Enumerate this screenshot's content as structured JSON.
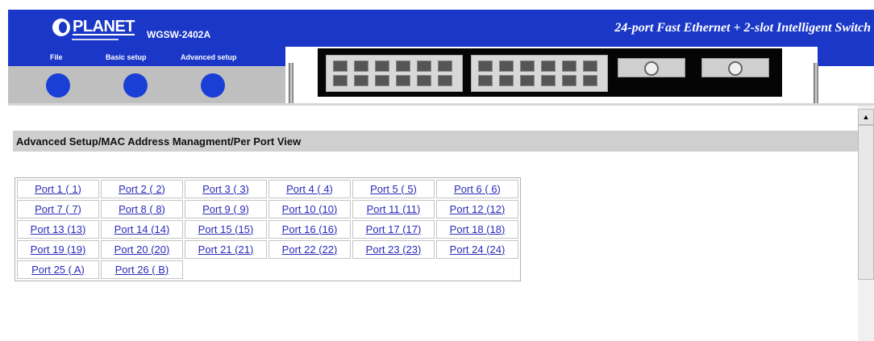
{
  "header": {
    "logo_text": "PLANET",
    "model": "WGSW-2402A",
    "tagline": "24-port Fast Ethernet + 2-slot Intelligent Switch"
  },
  "menu": {
    "items": [
      {
        "label": "File"
      },
      {
        "label": "Basic setup"
      },
      {
        "label": "Advanced setup"
      }
    ]
  },
  "content": {
    "title": "Advanced Setup/MAC Address Managment/Per Port View",
    "ports": [
      [
        "Port 1 ( 1)",
        "Port 2 ( 2)",
        "Port 3 ( 3)",
        "Port 4 ( 4)",
        "Port 5 ( 5)",
        "Port 6 ( 6)"
      ],
      [
        "Port 7 ( 7)",
        "Port 8 ( 8)",
        "Port 9 ( 9)",
        "Port 10 (10)",
        "Port 11 (11)",
        "Port 12 (12)"
      ],
      [
        "Port 13 (13)",
        "Port 14 (14)",
        "Port 15 (15)",
        "Port 16 (16)",
        "Port 17 (17)",
        "Port 18 (18)"
      ],
      [
        "Port 19 (19)",
        "Port 20 (20)",
        "Port 21 (21)",
        "Port 22 (22)",
        "Port 23 (23)",
        "Port 24 (24)"
      ],
      [
        "Port 25 ( A)",
        "Port 26 ( B)"
      ]
    ]
  },
  "colors": {
    "header_blue": "#1a37c8",
    "link": "#2b2bb8",
    "title_bar": "#cfcfcf"
  }
}
